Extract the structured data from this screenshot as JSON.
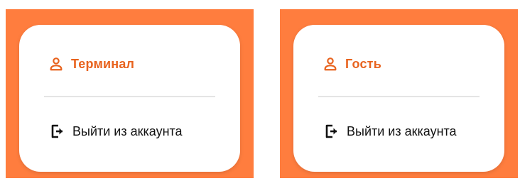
{
  "theme": {
    "accent": "#e8631e",
    "panel_background": "#ff7d3e",
    "card_background": "#ffffff"
  },
  "cards": [
    {
      "user_name": "Терминал",
      "user_icon": "person-icon",
      "logout_label": "Выйти из аккаунта",
      "logout_icon": "logout-icon"
    },
    {
      "user_name": "Гость",
      "user_icon": "person-icon",
      "logout_label": "Выйти из аккаунта",
      "logout_icon": "logout-icon"
    }
  ]
}
